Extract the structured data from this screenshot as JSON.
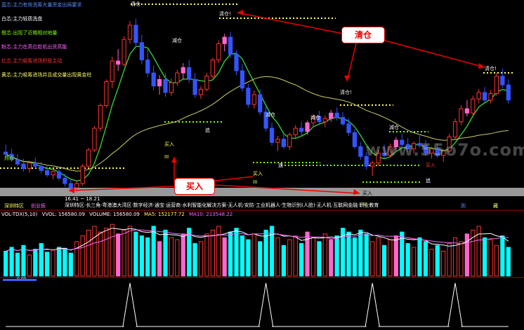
{
  "legend": [
    {
      "text": "蓝芯:主力有效洗筹大量资金出局要求",
      "color": "#5b8cff"
    },
    {
      "text": "白芯:主力轻质洗盘",
      "color": "#ffffff"
    },
    {
      "text": "橙芯:出现了近期相对地量",
      "color": "#7fff00"
    },
    {
      "text": "粉芯:主力在高位趁机出货高能",
      "color": "#ff66ff"
    },
    {
      "text": "红芯:主力吸筹进场积极主动",
      "color": "#ff3333"
    },
    {
      "text": "黄芯:主力吸筹进场并且成交量出现黄金柱",
      "color": "#ffff66"
    }
  ],
  "callouts": {
    "sell": "清仓",
    "buy": "买入"
  },
  "chart_labels": {
    "clear_top": "清仓",
    "clear_mid": "清仓!",
    "clear_right": "清仓!",
    "clear_right2": "清仓!",
    "reduce1": "减仓",
    "reduce2": "减仓",
    "reduce3": "减仓",
    "reduce4": "减仓",
    "buy1": "买入",
    "buy2": "买入",
    "buy3": "买入",
    "buy_small": "买入",
    "hold1": "持仓",
    "add1": "追",
    "add2": "追",
    "add3": "追",
    "mark_ll": "III",
    "mark_mid": "III",
    "mark_right": "III",
    "low_price": "16.41 ~ 18.21"
  },
  "ticker_text": "深圳特区·长三角·粤港澳大湾区·数字经济·通宝·运营商·水利智能化解决方案·无人机·安防·工业机器人·生物识别(人脸)·无人机·互联网金融·职业教育",
  "bottom_labels": {
    "left1": "深圳特区",
    "left2": "创业板",
    "right1": "则",
    "right2": "藏"
  },
  "vol_header": {
    "title": "VOL-TDX(5,10)",
    "vvol": "VVOL: 156580.09",
    "volume": "VOLUME: 156580.09",
    "ma5": "MA5: 152177.72",
    "ma10": "MA10: 213548.22"
  },
  "watermark": "www.55o7o.com",
  "indicator_value": "0.00",
  "colors": {
    "up": "#ff3333",
    "down": "#00ffff",
    "ma_green": "#33cc33",
    "ma_yellow": "#cccc66",
    "pink": "#ff66cc",
    "vol_ma": "#ff66ff"
  },
  "chart_data": [
    {
      "type": "candlestick",
      "title": "",
      "series": [
        {
          "name": "price",
          "values": [
            {
              "o": 20.1,
              "h": 20.8,
              "l": 19.6,
              "c": 19.9,
              "k": "down"
            },
            {
              "o": 19.9,
              "h": 20.4,
              "l": 19.2,
              "c": 19.4,
              "k": "down"
            },
            {
              "o": 19.4,
              "h": 19.9,
              "l": 18.8,
              "c": 19.0,
              "k": "down"
            },
            {
              "o": 19.0,
              "h": 19.5,
              "l": 18.3,
              "c": 18.6,
              "k": "down"
            },
            {
              "o": 18.6,
              "h": 19.3,
              "l": 18.2,
              "c": 19.1,
              "k": "up"
            },
            {
              "o": 19.1,
              "h": 19.6,
              "l": 18.6,
              "c": 18.8,
              "k": "down"
            },
            {
              "o": 18.8,
              "h": 19.2,
              "l": 18.1,
              "c": 18.4,
              "k": "down"
            },
            {
              "o": 18.4,
              "h": 18.8,
              "l": 17.8,
              "c": 18.0,
              "k": "down"
            },
            {
              "o": 18.0,
              "h": 18.6,
              "l": 17.6,
              "c": 18.3,
              "k": "up"
            },
            {
              "o": 18.3,
              "h": 18.7,
              "l": 17.5,
              "c": 17.7,
              "k": "down"
            },
            {
              "o": 17.7,
              "h": 18.1,
              "l": 16.9,
              "c": 17.2,
              "k": "down"
            },
            {
              "o": 17.2,
              "h": 17.6,
              "l": 16.5,
              "c": 16.8,
              "k": "down"
            },
            {
              "o": 16.8,
              "h": 17.4,
              "l": 16.4,
              "c": 17.2,
              "k": "up"
            },
            {
              "o": 17.2,
              "h": 19.0,
              "l": 17.0,
              "c": 18.8,
              "k": "up"
            },
            {
              "o": 18.8,
              "h": 20.5,
              "l": 18.6,
              "c": 20.3,
              "k": "up"
            },
            {
              "o": 20.3,
              "h": 22.5,
              "l": 20.1,
              "c": 22.3,
              "k": "up"
            },
            {
              "o": 22.3,
              "h": 24.6,
              "l": 22.0,
              "c": 24.4,
              "k": "up"
            },
            {
              "o": 24.4,
              "h": 26.8,
              "l": 24.2,
              "c": 26.6,
              "k": "up"
            },
            {
              "o": 26.6,
              "h": 28.9,
              "l": 26.0,
              "c": 28.5,
              "k": "up"
            },
            {
              "o": 28.5,
              "h": 29.6,
              "l": 27.6,
              "c": 28.2,
              "k": "pink"
            },
            {
              "o": 28.2,
              "h": 30.8,
              "l": 28.0,
              "c": 30.5,
              "k": "up"
            },
            {
              "o": 30.5,
              "h": 32.2,
              "l": 30.1,
              "c": 31.8,
              "k": "up"
            },
            {
              "o": 31.8,
              "h": 32.4,
              "l": 29.8,
              "c": 30.2,
              "k": "down"
            },
            {
              "o": 30.2,
              "h": 30.9,
              "l": 28.2,
              "c": 28.6,
              "k": "down"
            },
            {
              "o": 28.6,
              "h": 29.6,
              "l": 27.0,
              "c": 27.4,
              "k": "down"
            },
            {
              "o": 27.4,
              "h": 28.1,
              "l": 25.8,
              "c": 26.2,
              "k": "down"
            },
            {
              "o": 26.2,
              "h": 27.2,
              "l": 25.4,
              "c": 26.8,
              "k": "pink"
            },
            {
              "o": 26.8,
              "h": 27.4,
              "l": 25.2,
              "c": 25.6,
              "k": "down"
            },
            {
              "o": 25.6,
              "h": 26.9,
              "l": 25.3,
              "c": 26.5,
              "k": "up"
            },
            {
              "o": 26.5,
              "h": 27.7,
              "l": 26.2,
              "c": 27.4,
              "k": "up"
            },
            {
              "o": 27.4,
              "h": 28.3,
              "l": 26.8,
              "c": 27.9,
              "k": "pink"
            },
            {
              "o": 27.9,
              "h": 28.6,
              "l": 26.5,
              "c": 26.8,
              "k": "down"
            },
            {
              "o": 26.8,
              "h": 27.4,
              "l": 25.1,
              "c": 25.4,
              "k": "down"
            },
            {
              "o": 25.4,
              "h": 26.2,
              "l": 25.0,
              "c": 25.9,
              "k": "up"
            },
            {
              "o": 25.9,
              "h": 27.4,
              "l": 25.7,
              "c": 27.1,
              "k": "up"
            },
            {
              "o": 27.1,
              "h": 28.8,
              "l": 26.9,
              "c": 28.6,
              "k": "up"
            },
            {
              "o": 28.6,
              "h": 30.4,
              "l": 28.3,
              "c": 30.1,
              "k": "up"
            },
            {
              "o": 30.1,
              "h": 31.0,
              "l": 29.4,
              "c": 30.7,
              "k": "pink"
            },
            {
              "o": 30.7,
              "h": 31.2,
              "l": 28.8,
              "c": 29.1,
              "k": "down"
            },
            {
              "o": 29.1,
              "h": 29.5,
              "l": 27.2,
              "c": 27.6,
              "k": "down"
            },
            {
              "o": 27.6,
              "h": 28.2,
              "l": 25.7,
              "c": 26.0,
              "k": "down"
            },
            {
              "o": 26.0,
              "h": 26.4,
              "l": 24.2,
              "c": 24.5,
              "k": "down"
            },
            {
              "o": 24.5,
              "h": 25.8,
              "l": 24.1,
              "c": 25.4,
              "k": "up"
            },
            {
              "o": 25.4,
              "h": 25.9,
              "l": 23.5,
              "c": 23.8,
              "k": "down"
            },
            {
              "o": 23.8,
              "h": 24.3,
              "l": 22.0,
              "c": 22.3,
              "k": "down"
            },
            {
              "o": 22.3,
              "h": 22.8,
              "l": 20.7,
              "c": 21.0,
              "k": "down"
            },
            {
              "o": 21.0,
              "h": 21.6,
              "l": 20.2,
              "c": 21.3,
              "k": "up"
            },
            {
              "o": 21.3,
              "h": 21.8,
              "l": 20.4,
              "c": 20.6,
              "k": "down"
            },
            {
              "o": 20.6,
              "h": 21.9,
              "l": 20.3,
              "c": 21.7,
              "k": "up"
            },
            {
              "o": 21.7,
              "h": 22.6,
              "l": 21.3,
              "c": 22.3,
              "k": "up"
            },
            {
              "o": 22.3,
              "h": 22.9,
              "l": 21.6,
              "c": 22.0,
              "k": "down"
            },
            {
              "o": 22.0,
              "h": 23.0,
              "l": 21.7,
              "c": 22.8,
              "k": "pink"
            },
            {
              "o": 22.8,
              "h": 23.6,
              "l": 22.4,
              "c": 23.4,
              "k": "up"
            },
            {
              "o": 23.4,
              "h": 23.9,
              "l": 22.6,
              "c": 22.9,
              "k": "down"
            },
            {
              "o": 22.9,
              "h": 23.5,
              "l": 22.4,
              "c": 23.2,
              "k": "up"
            },
            {
              "o": 23.2,
              "h": 24.0,
              "l": 22.9,
              "c": 23.7,
              "k": "pink"
            },
            {
              "o": 23.7,
              "h": 24.2,
              "l": 23.0,
              "c": 23.3,
              "k": "down"
            },
            {
              "o": 23.3,
              "h": 23.8,
              "l": 22.5,
              "c": 22.7,
              "k": "down"
            },
            {
              "o": 22.7,
              "h": 23.2,
              "l": 21.6,
              "c": 21.9,
              "k": "down"
            },
            {
              "o": 21.9,
              "h": 22.2,
              "l": 20.4,
              "c": 20.6,
              "k": "down"
            },
            {
              "o": 20.6,
              "h": 21.0,
              "l": 19.4,
              "c": 19.7,
              "k": "down"
            },
            {
              "o": 19.7,
              "h": 20.1,
              "l": 18.5,
              "c": 18.8,
              "k": "down"
            },
            {
              "o": 18.8,
              "h": 19.3,
              "l": 17.9,
              "c": 19.1,
              "k": "up"
            },
            {
              "o": 19.1,
              "h": 20.3,
              "l": 18.8,
              "c": 20.0,
              "k": "up"
            },
            {
              "o": 20.0,
              "h": 20.8,
              "l": 19.5,
              "c": 19.8,
              "k": "down"
            },
            {
              "o": 19.8,
              "h": 20.9,
              "l": 19.6,
              "c": 20.6,
              "k": "up"
            },
            {
              "o": 20.6,
              "h": 21.5,
              "l": 20.2,
              "c": 21.2,
              "k": "pink"
            },
            {
              "o": 21.2,
              "h": 21.8,
              "l": 20.5,
              "c": 20.8,
              "k": "down"
            },
            {
              "o": 20.8,
              "h": 21.4,
              "l": 20.1,
              "c": 20.4,
              "k": "down"
            },
            {
              "o": 20.4,
              "h": 21.1,
              "l": 20.0,
              "c": 20.9,
              "k": "up"
            },
            {
              "o": 20.9,
              "h": 21.6,
              "l": 20.5,
              "c": 20.7,
              "k": "down"
            },
            {
              "o": 20.7,
              "h": 21.2,
              "l": 19.8,
              "c": 20.0,
              "k": "down"
            },
            {
              "o": 20.0,
              "h": 20.6,
              "l": 19.5,
              "c": 20.4,
              "k": "up"
            },
            {
              "o": 20.4,
              "h": 20.9,
              "l": 19.6,
              "c": 19.8,
              "k": "down"
            },
            {
              "o": 19.8,
              "h": 20.4,
              "l": 19.2,
              "c": 20.2,
              "k": "up"
            },
            {
              "o": 20.2,
              "h": 21.8,
              "l": 20.0,
              "c": 21.5,
              "k": "up"
            },
            {
              "o": 21.5,
              "h": 23.2,
              "l": 21.3,
              "c": 22.9,
              "k": "up"
            },
            {
              "o": 22.9,
              "h": 24.4,
              "l": 22.6,
              "c": 24.1,
              "k": "up"
            },
            {
              "o": 24.1,
              "h": 24.9,
              "l": 23.4,
              "c": 23.7,
              "k": "pink"
            },
            {
              "o": 23.7,
              "h": 25.3,
              "l": 23.5,
              "c": 25.0,
              "k": "up"
            },
            {
              "o": 25.0,
              "h": 25.9,
              "l": 24.6,
              "c": 25.6,
              "k": "up"
            },
            {
              "o": 25.6,
              "h": 26.1,
              "l": 24.7,
              "c": 24.9,
              "k": "down"
            },
            {
              "o": 24.9,
              "h": 25.8,
              "l": 24.6,
              "c": 25.5,
              "k": "up"
            },
            {
              "o": 25.5,
              "h": 27.4,
              "l": 25.3,
              "c": 27.1,
              "k": "up"
            },
            {
              "o": 27.1,
              "h": 27.8,
              "l": 26.0,
              "c": 26.3,
              "k": "down"
            },
            {
              "o": 26.3,
              "h": 26.8,
              "l": 24.6,
              "c": 24.9,
              "k": "down"
            }
          ]
        }
      ],
      "ylim": [
        15,
        34
      ]
    },
    {
      "type": "bar",
      "title": "VOL-TDX(5,10)",
      "series": [
        {
          "name": "VOLUME",
          "values": [
            130,
            150,
            120,
            160,
            110,
            140,
            170,
            125,
            135,
            150,
            145,
            120,
            180,
            210,
            240,
            260,
            230,
            250,
            270,
            220,
            240,
            260,
            230,
            210,
            200,
            260,
            180,
            240,
            200,
            190,
            220,
            250,
            170,
            180,
            220,
            240,
            260,
            200,
            230,
            250,
            210,
            190,
            220,
            180,
            240,
            260,
            200,
            160,
            190,
            210,
            170,
            230,
            200,
            180,
            220,
            190,
            210,
            250,
            230,
            200,
            240,
            220,
            180,
            200,
            160,
            190,
            210,
            230,
            170,
            150,
            200,
            180,
            140,
            160,
            130,
            170,
            200,
            180,
            220,
            240,
            260,
            200,
            190,
            160,
            210,
            150
          ]
        }
      ],
      "ylim": [
        0,
        300
      ]
    },
    {
      "type": "line",
      "title": "",
      "series": [
        {
          "name": "signal",
          "values": [
            0,
            0,
            0,
            0,
            0,
            0,
            0,
            0,
            0,
            0,
            0,
            0,
            0,
            0,
            0,
            0,
            0,
            0,
            0,
            0,
            0,
            1,
            0,
            0,
            0,
            0,
            0,
            0,
            0,
            0,
            0,
            0,
            0,
            0,
            0,
            0,
            0,
            0,
            0,
            0,
            0,
            0,
            0,
            0,
            1,
            0,
            0,
            0,
            0,
            0,
            0,
            0,
            0,
            0,
            0,
            0,
            0,
            0,
            0,
            0,
            0,
            0,
            1,
            0,
            0,
            0,
            0,
            0,
            0,
            0,
            0,
            0,
            0,
            0,
            0,
            0,
            1,
            0,
            0,
            0,
            0,
            0,
            0,
            0,
            0,
            0
          ]
        }
      ],
      "ylim": [
        0,
        1
      ]
    }
  ]
}
